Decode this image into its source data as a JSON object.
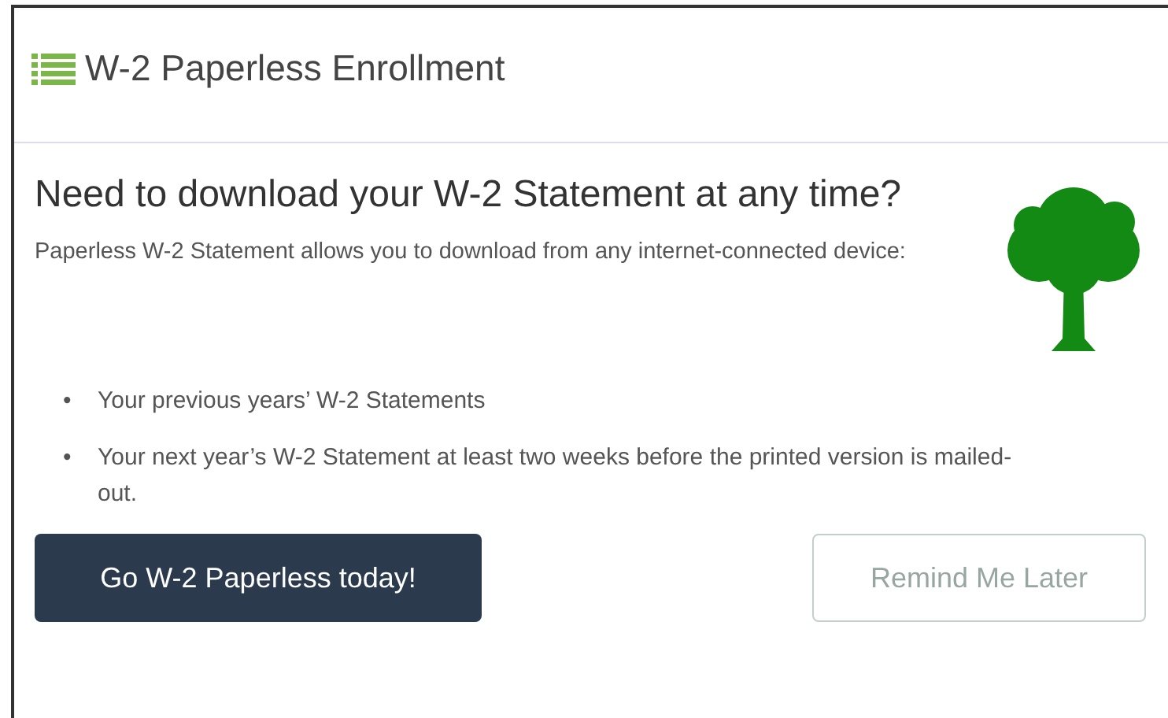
{
  "panel": {
    "title": "W-2 Paperless Enrollment"
  },
  "heading": "Need to download your W-2 Statement at any time?",
  "intro": "Paperless W-2 Statement allows you to download from any internet-connected device:",
  "bullets": [
    {
      "marker": "•",
      "text": "Your previous years’ W-2 Statements"
    },
    {
      "marker": "•",
      "text": "Your next year’s W-2 Statement at least two weeks before the printed version is mailed-out."
    }
  ],
  "buttons": [
    {
      "label": "Go W-2 Paperless today!",
      "kind": "primary"
    },
    {
      "label": "Remind Me Later",
      "kind": "secondary"
    }
  ]
}
